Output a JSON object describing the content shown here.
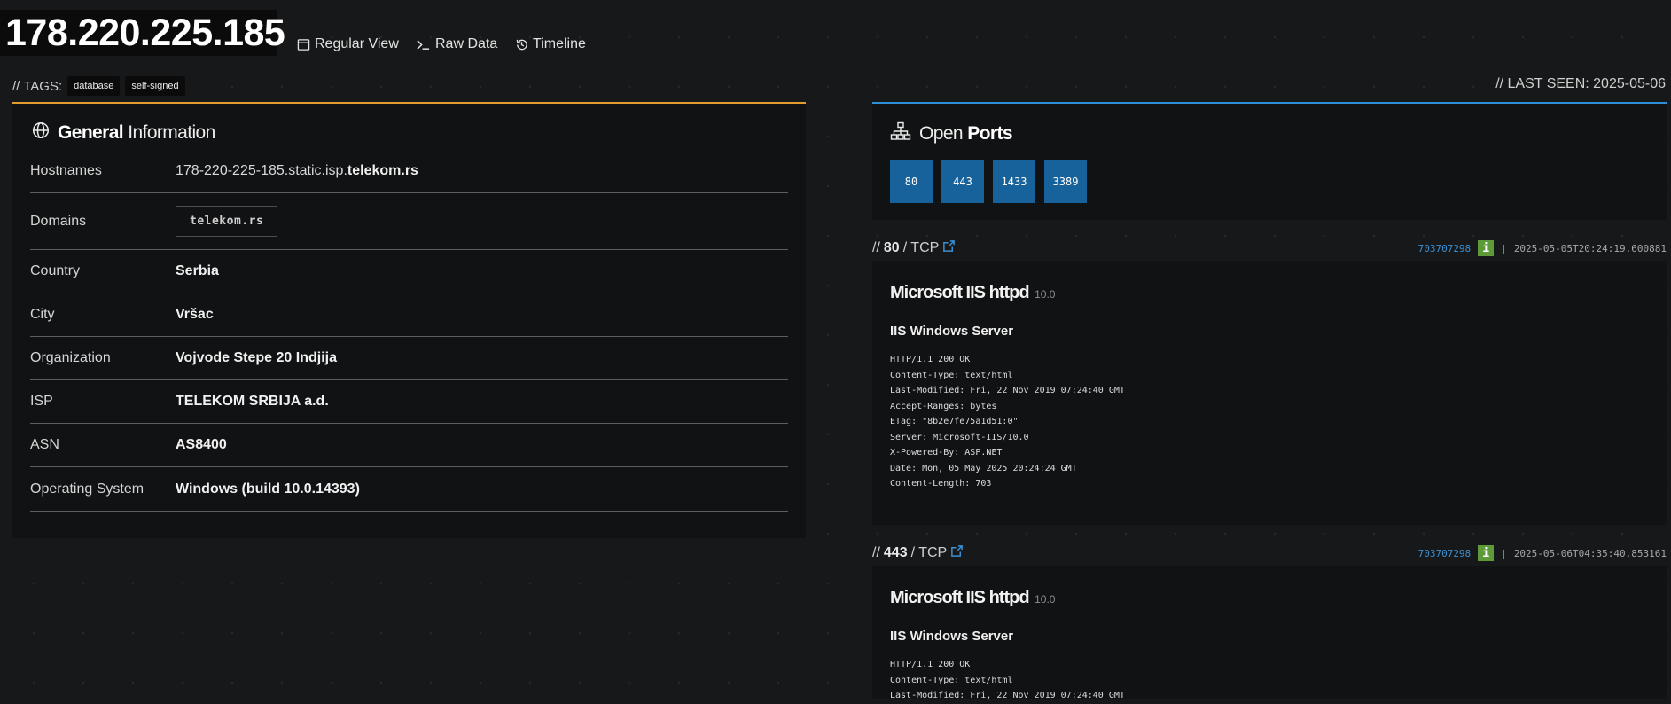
{
  "header": {
    "ip": "178.220.225.185",
    "nav": [
      {
        "label": "Regular View",
        "icon": "window-icon"
      },
      {
        "label": "Raw Data",
        "icon": "terminal-icon"
      },
      {
        "label": "Timeline",
        "icon": "history-icon"
      }
    ],
    "tags_label": "// TAGS:",
    "tags": [
      "database",
      "self-signed"
    ],
    "last_seen": "//  LAST SEEN: 2025-05-06"
  },
  "general": {
    "title_bold": "General",
    "title_rest": "Information",
    "icon": "globe-icon",
    "rows": {
      "hostnames": {
        "label": "Hostnames",
        "value_prefix": "178-220-225-185.static.isp.",
        "value_bold": "telekom.rs"
      },
      "domains": {
        "label": "Domains",
        "value": "telekom.rs"
      },
      "country": {
        "label": "Country",
        "value": "Serbia"
      },
      "city": {
        "label": "City",
        "value": "Vršac"
      },
      "organization": {
        "label": "Organization",
        "value": "Vojvode Stepe 20 Indjija"
      },
      "isp": {
        "label": "ISP",
        "value": "TELEKOM SRBIJA a.d."
      },
      "asn": {
        "label": "ASN",
        "value": "AS8400"
      },
      "os": {
        "label": "Operating System",
        "value": "Windows (build 10.0.14393)"
      }
    }
  },
  "ports": {
    "title_light": "Open",
    "title_bold": "Ports",
    "icon": "sitemap-icon",
    "list": [
      "80",
      "443",
      "1433",
      "3389"
    ]
  },
  "services": [
    {
      "prefix": "//",
      "port": "80",
      "proto": "/ TCP",
      "hash": "703707298",
      "info_icon": "i",
      "sep": "|",
      "timestamp": "2025-05-05T20:24:19.600881",
      "product": "Microsoft IIS httpd",
      "version": "10.0",
      "title": "IIS Windows Server",
      "banner": "HTTP/1.1 200 OK\nContent-Type: text/html\nLast-Modified: Fri, 22 Nov 2019 07:24:40 GMT\nAccept-Ranges: bytes\nETag: \"8b2e7fe75a1d51:0\"\nServer: Microsoft-IIS/10.0\nX-Powered-By: ASP.NET\nDate: Mon, 05 May 2025 20:24:24 GMT\nContent-Length: 703"
    },
    {
      "prefix": "//",
      "port": "443",
      "proto": "/ TCP",
      "hash": "703707298",
      "info_icon": "i",
      "sep": "|",
      "timestamp": "2025-05-06T04:35:40.853161",
      "product": "Microsoft IIS httpd",
      "version": "10.0",
      "title": "IIS Windows Server",
      "banner": "HTTP/1.1 200 OK\nContent-Type: text/html\nLast-Modified: Fri, 22 Nov 2019 07:24:40 GMT"
    }
  ],
  "colors": {
    "accent_orange": "#e39b2d",
    "accent_blue": "#2f8fd6",
    "port_button": "#17629a",
    "hash_link": "#3b8fd2",
    "info_badge": "#5f9a3a"
  }
}
